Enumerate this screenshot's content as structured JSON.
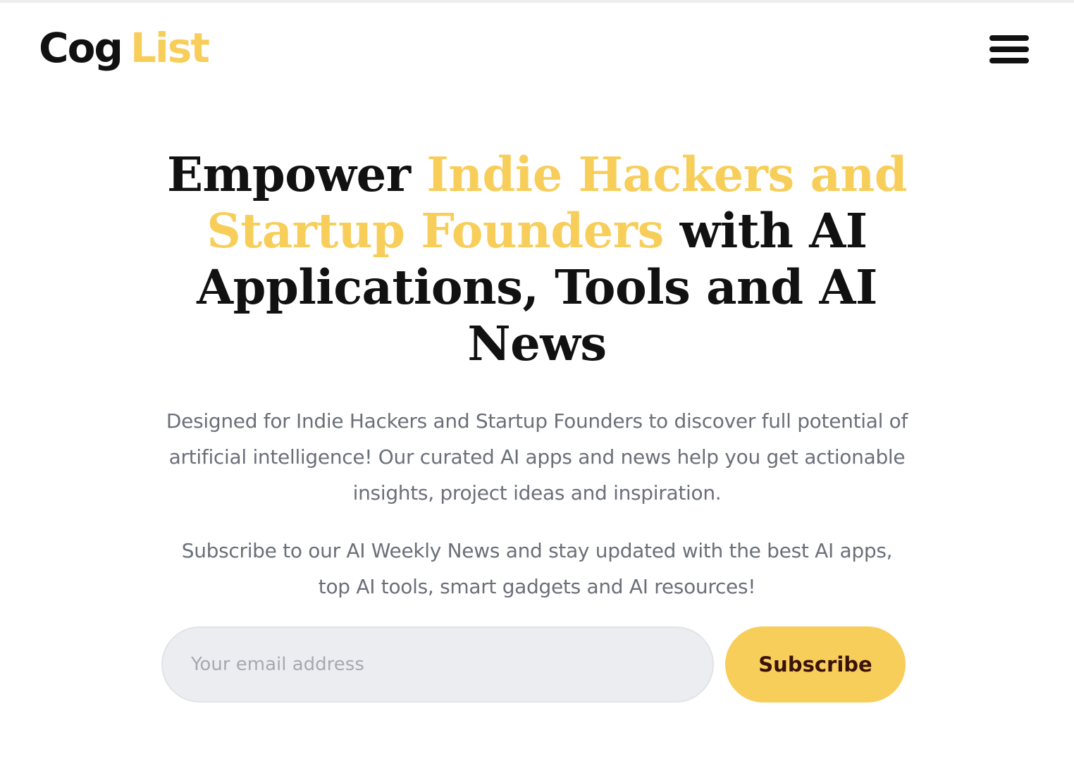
{
  "header": {
    "logo_part1": "Cog",
    "logo_part2": "List",
    "menu_icon": "hamburger-menu-icon"
  },
  "hero": {
    "title_part1": "Empower ",
    "title_accent": "Indie Hackers and Startup Founders",
    "title_part2": " with AI Applications, Tools and AI News",
    "description": "Designed for Indie Hackers and Startup Founders to discover full potential of artificial intelligence! Our curated AI apps and news help you get actionable insights, project ideas and inspiration.",
    "subscribe_text": "Subscribe to our AI Weekly News and stay updated with the best AI apps, top AI tools, smart gadgets and AI resources!"
  },
  "subscribe": {
    "email_placeholder": "Your email address",
    "button_label": "Subscribe"
  },
  "colors": {
    "accent": "#f8ce5b",
    "text_dark": "#111111",
    "text_muted": "#6b6f78",
    "input_bg": "#ecedf1",
    "button_text": "#3a1208"
  }
}
